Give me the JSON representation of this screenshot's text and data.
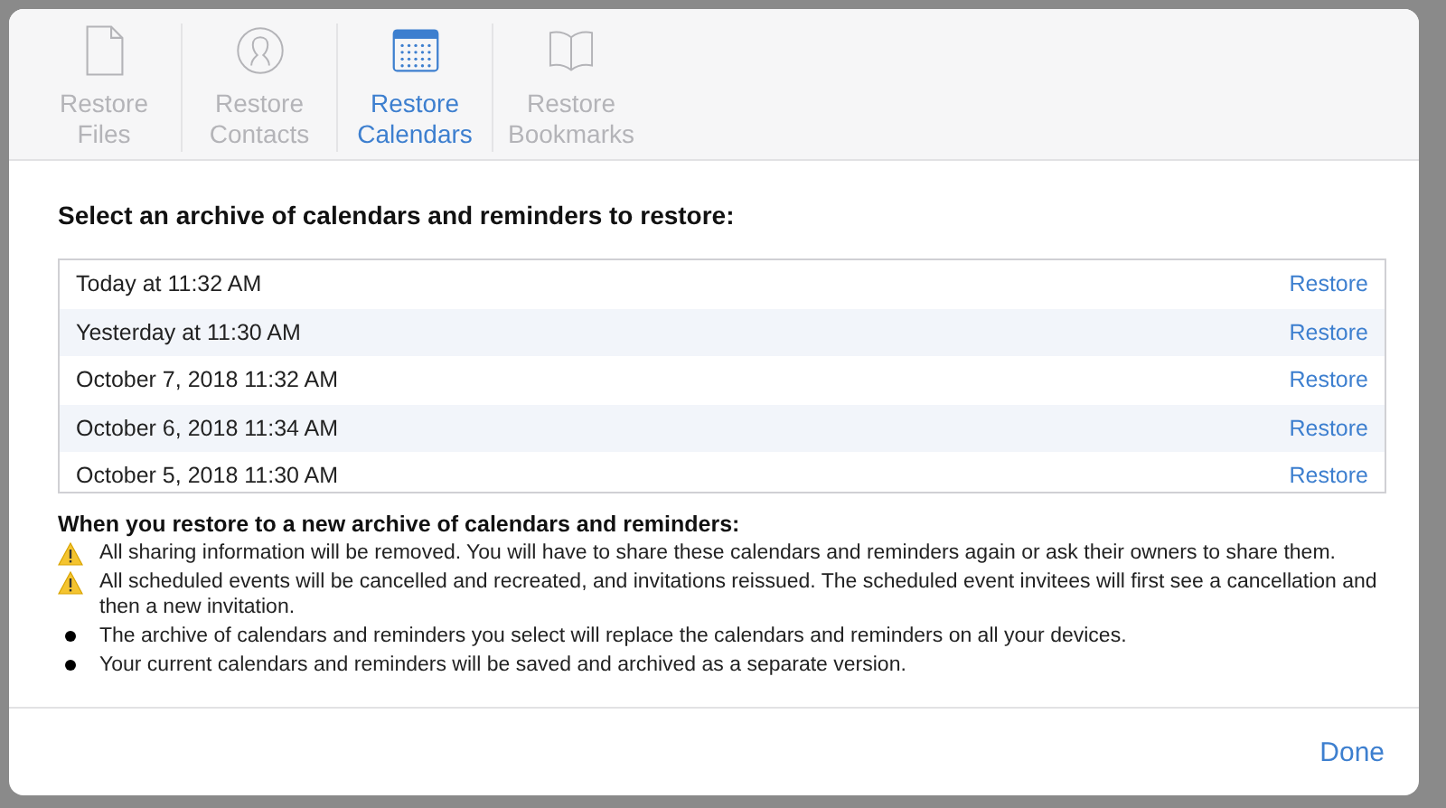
{
  "tabs": [
    {
      "kind": "file",
      "line1": "Restore",
      "line2": "Files",
      "selected": false
    },
    {
      "kind": "contact",
      "line1": "Restore",
      "line2": "Contacts",
      "selected": false
    },
    {
      "kind": "calendar",
      "line1": "Restore",
      "line2": "Calendars",
      "selected": true
    },
    {
      "kind": "bookmark",
      "line1": "Restore",
      "line2": "Bookmarks",
      "selected": false
    }
  ],
  "heading": "Select an archive of calendars and reminders to restore:",
  "archives": [
    {
      "date": "Today at 11:32 AM",
      "action": "Restore"
    },
    {
      "date": "Yesterday at 11:30 AM",
      "action": "Restore"
    },
    {
      "date": "October 7, 2018 11:32 AM",
      "action": "Restore"
    },
    {
      "date": "October 6, 2018 11:34 AM",
      "action": "Restore"
    },
    {
      "date": "October 5, 2018 11:30 AM",
      "action": "Restore"
    }
  ],
  "notes_title": "When you restore to a new archive of calendars and reminders:",
  "notes": [
    {
      "kind": "warning",
      "text": "All sharing information will be removed. You will have to share these calendars and reminders again or ask their owners to share them."
    },
    {
      "kind": "warning",
      "text": "All scheduled events will be cancelled and recreated, and invitations reissued. The scheduled event invitees will first see a cancellation and then a new invitation."
    },
    {
      "kind": "bullet",
      "text": "The archive of calendars and reminders you select will replace the calendars and reminders on all your devices."
    },
    {
      "kind": "bullet",
      "text": "Your current calendars and reminders will be saved and archived as a separate version."
    }
  ],
  "done": "Done"
}
